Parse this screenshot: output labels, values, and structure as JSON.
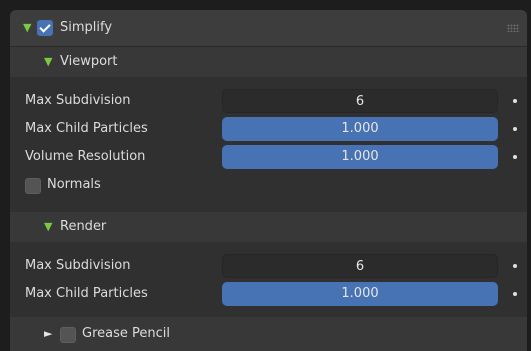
{
  "simplify": {
    "title": "Simplify",
    "enabled": true,
    "viewport": {
      "title": "Viewport",
      "max_subdivision_label": "Max Subdivision",
      "max_subdivision_value": "6",
      "max_child_particles_label": "Max Child Particles",
      "max_child_particles_value": "1.000",
      "volume_resolution_label": "Volume Resolution",
      "volume_resolution_value": "1.000",
      "normals_label": "Normals",
      "normals_enabled": false
    },
    "render": {
      "title": "Render",
      "max_subdivision_label": "Max Subdivision",
      "max_subdivision_value": "6",
      "max_child_particles_label": "Max Child Particles",
      "max_child_particles_value": "1.000"
    },
    "grease_pencil": {
      "title": "Grease Pencil",
      "enabled": false
    }
  },
  "icons": {
    "expanded": "triangle-down",
    "collapsed": "triangle-right",
    "drag": "grip-dots"
  },
  "colors": {
    "accent": "#4772b3",
    "expand_arrow": "#7ac943"
  }
}
